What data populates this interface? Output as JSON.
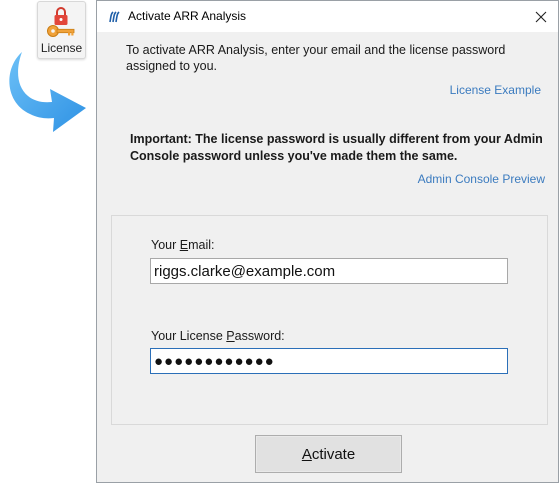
{
  "toolbar_tile": {
    "label": "License",
    "icon": "lock-key-icon"
  },
  "window": {
    "title": "Activate ARR Analysis",
    "app_icon": "app-logo-icon",
    "close_icon": "close-icon"
  },
  "intro": {
    "text": "To activate ARR Analysis, enter your email and the license password assigned to you."
  },
  "links": {
    "license_example": "License Example",
    "admin_console_preview": "Admin Console Preview"
  },
  "important": {
    "text": "Important: The license password is usually different from your Admin Console password unless you've made them the same."
  },
  "form": {
    "email_label_prefix": "Your ",
    "email_label_mnemonic": "E",
    "email_label_rest": "mail:",
    "email_value": "riggs.clarke@example.com",
    "password_label_prefix": "Your License ",
    "password_label_mnemonic": "P",
    "password_label_rest": "assword:",
    "password_masked": "●●●●●●●●●●●●"
  },
  "buttons": {
    "activate_mnemonic": "A",
    "activate_rest": "ctivate"
  },
  "colors": {
    "link": "#3b7bbf",
    "arrow": "#3fa3ee",
    "focus_border": "#2b6fb8"
  }
}
